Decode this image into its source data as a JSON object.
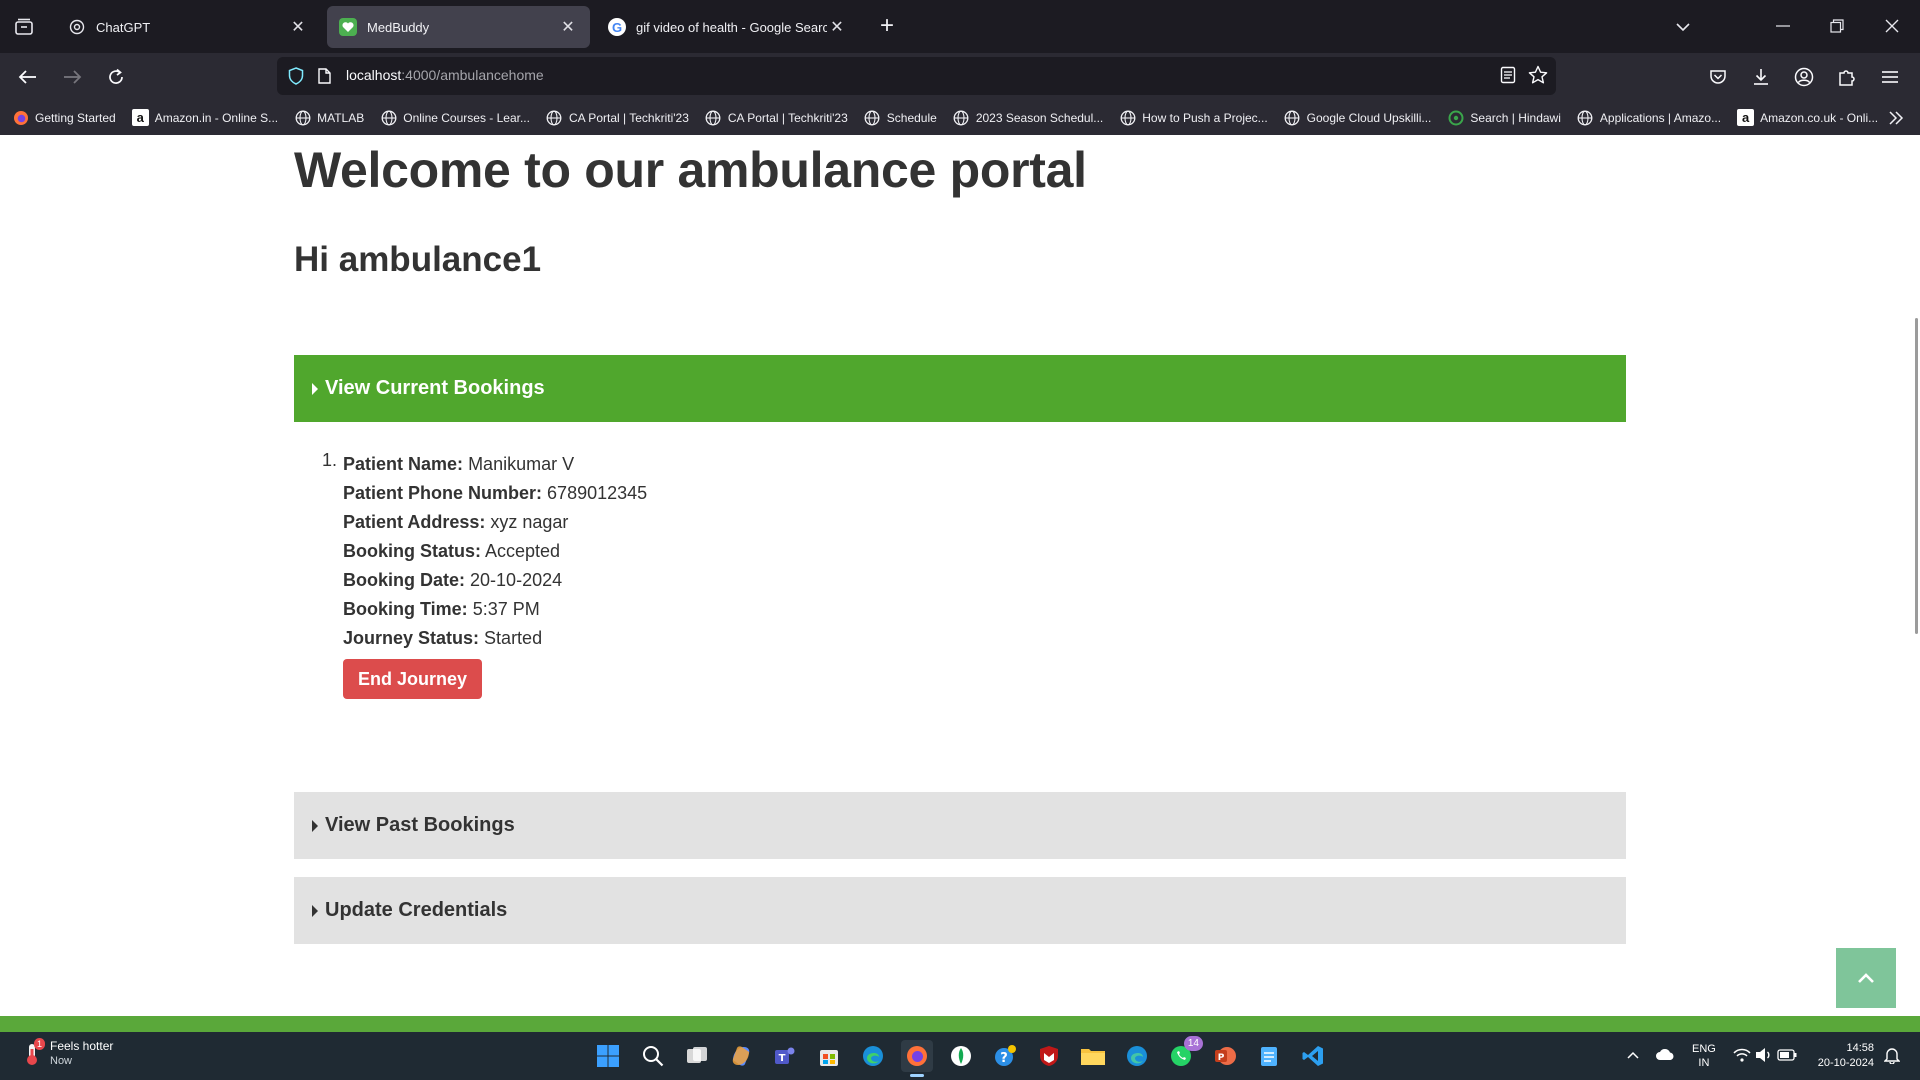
{
  "browser": {
    "tabs": [
      {
        "title": "ChatGPT",
        "active": false,
        "icon": "chatgpt-icon"
      },
      {
        "title": "MedBuddy",
        "active": true,
        "icon": "medbuddy-icon"
      },
      {
        "title": "gif video of health - Google Search",
        "active": false,
        "icon": "google-icon"
      }
    ],
    "url_host": "localhost",
    "url_path": ":4000/ambulancehome",
    "bookmarks": [
      {
        "label": "Getting Started",
        "icon": "firefox-icon"
      },
      {
        "label": "Amazon.in - Online S...",
        "icon": "amazon-icon"
      },
      {
        "label": "MATLAB",
        "icon": "globe-icon"
      },
      {
        "label": "Online Courses - Lear...",
        "icon": "globe-icon"
      },
      {
        "label": "CA Portal | Techkriti'23",
        "icon": "globe-icon"
      },
      {
        "label": "CA Portal | Techkriti'23",
        "icon": "globe-icon"
      },
      {
        "label": "Schedule",
        "icon": "globe-icon"
      },
      {
        "label": "2023 Season Schedul...",
        "icon": "globe-icon"
      },
      {
        "label": "How to Push a Projec...",
        "icon": "globe-icon"
      },
      {
        "label": "Google Cloud Upskilli...",
        "icon": "globe-icon"
      },
      {
        "label": "Search | Hindawi",
        "icon": "hindawi-icon"
      },
      {
        "label": "Applications | Amazo...",
        "icon": "globe-icon"
      },
      {
        "label": "Amazon.co.uk - Onli...",
        "icon": "amazon-icon"
      }
    ]
  },
  "page": {
    "title": "Welcome to our ambulance portal",
    "greeting": "Hi ambulance1",
    "sections": {
      "current": "View Current Bookings",
      "past": "View Past Bookings",
      "credentials": "Update Credentials"
    },
    "booking": {
      "number": "1.",
      "fields": [
        {
          "label": "Patient Name:",
          "value": "Manikumar V"
        },
        {
          "label": "Patient Phone Number:",
          "value": "6789012345"
        },
        {
          "label": "Patient Address:",
          "value": "xyz nagar"
        },
        {
          "label": "Booking Status:",
          "value": "Accepted"
        },
        {
          "label": "Booking Date:",
          "value": "20-10-2024"
        },
        {
          "label": "Booking Time:",
          "value": "5:37 PM"
        },
        {
          "label": "Journey Status:",
          "value": "Started"
        }
      ],
      "end_button": "End Journey"
    },
    "colors": {
      "accent_green": "#50a72d",
      "danger_red": "#dc4c4c",
      "section_gray": "#e2e2e2"
    }
  },
  "taskbar": {
    "weather_title": "Feels hotter",
    "weather_sub": "Now",
    "weather_badge": "1",
    "whatsapp_badge": "14",
    "lang_line1": "ENG",
    "lang_line2": "IN",
    "time": "14:58",
    "date": "20-10-2024"
  }
}
